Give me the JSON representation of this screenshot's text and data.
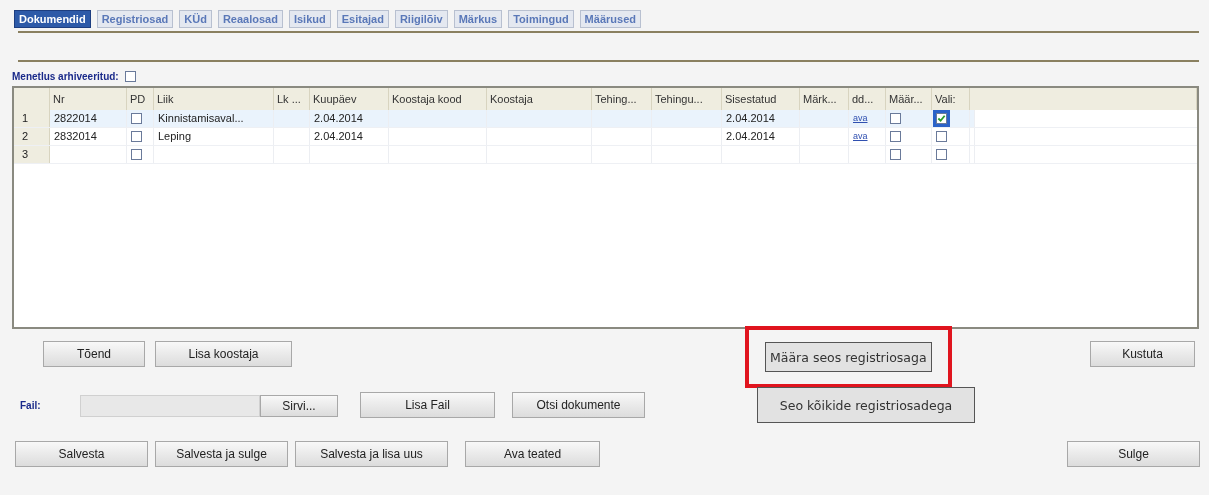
{
  "tabs": [
    {
      "label": "Dokumendid",
      "selected": true
    },
    {
      "label": "Registriosad",
      "selected": false
    },
    {
      "label": "KÜd",
      "selected": false
    },
    {
      "label": "Reaalosad",
      "selected": false
    },
    {
      "label": "Isikud",
      "selected": false
    },
    {
      "label": "Esitajad",
      "selected": false
    },
    {
      "label": "Riigilõiv",
      "selected": false
    },
    {
      "label": "Märkus",
      "selected": false
    },
    {
      "label": "Toimingud",
      "selected": false
    },
    {
      "label": "Määrused",
      "selected": false
    }
  ],
  "archived": {
    "label": "Menetlus arhiveeritud:",
    "checked": false
  },
  "table": {
    "columns": [
      "Nr",
      "PD",
      "Liik",
      "Lk ...",
      "Kuupäev",
      "Koostaja kood",
      "Koostaja",
      "Tehing...",
      "Tehingu...",
      "Sisestatud",
      "Märk...",
      "dd...",
      "Määr...",
      "Vali:"
    ],
    "rows": [
      {
        "number": "1",
        "nr": "2822014",
        "pd": false,
        "liik": "Kinnistamisaval...",
        "kuupaev": "2.04.2014",
        "sisestatud": "2.04.2014",
        "link": "ava",
        "maar": false,
        "vali": true,
        "selected": true
      },
      {
        "number": "2",
        "nr": "2832014",
        "pd": false,
        "liik": "Leping",
        "kuupaev": "2.04.2014",
        "sisestatud": "2.04.2014",
        "link": "ava",
        "maar": false,
        "vali": false,
        "selected": false
      },
      {
        "number": "3",
        "pd": false,
        "maar": false,
        "vali": false,
        "selected": false
      }
    ]
  },
  "buttons_row1": {
    "left": [
      "Tõend",
      "Lisa koostaja"
    ],
    "link_button": {
      "label": "Määra seos registriosaga",
      "highlighted": true
    },
    "right": "Kustuta"
  },
  "file_row": {
    "label": "Fail:",
    "browse": "Sirvi...",
    "buttons": [
      "Lisa Fail",
      "Otsi dokumente"
    ],
    "link_all": "Seo kõikide registriosadega"
  },
  "buttons_row3": {
    "left": [
      "Salvesta",
      "Salvesta ja sulge",
      "Salvesta ja lisa uus",
      "Ava teated"
    ],
    "right": "Sulge"
  }
}
